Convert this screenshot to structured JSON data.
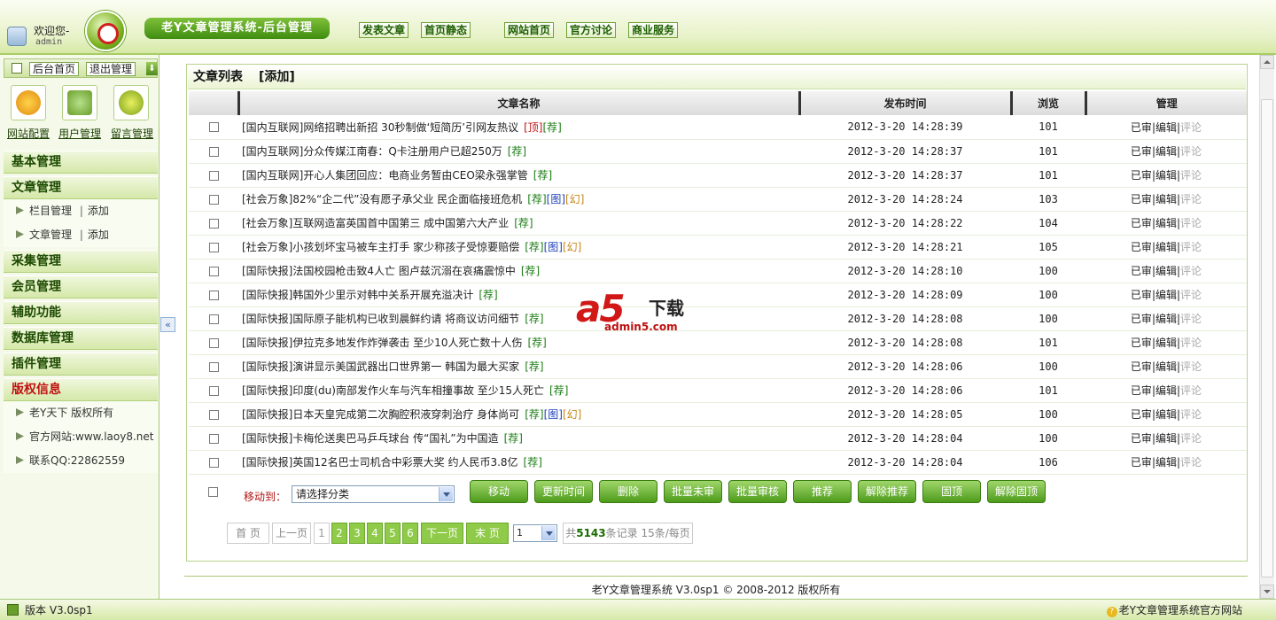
{
  "header": {
    "welcome": "欢迎您-",
    "username": "admin",
    "system_title": "老Y文章管理系统-后台管理",
    "nav": [
      "发表文章",
      "首页静态",
      "网站首页",
      "官方讨论",
      "商业服务"
    ]
  },
  "sidebar": {
    "buttons": {
      "home": "后台首页",
      "logout": "退出管理"
    },
    "icons": [
      {
        "label": "网站配置",
        "icon": "gear-icon"
      },
      {
        "label": "用户管理",
        "icon": "user-manage-icon"
      },
      {
        "label": "留言管理",
        "icon": "message-icon"
      }
    ],
    "sections": {
      "basic": "基本管理",
      "article": "文章管理",
      "article_items": [
        {
          "label": "栏目管理",
          "sep": "|",
          "action": "添加"
        },
        {
          "label": "文章管理",
          "sep": "|",
          "action": "添加"
        }
      ],
      "collect": "采集管理",
      "member": "会员管理",
      "assist": "辅助功能",
      "database": "数据库管理",
      "plugin": "插件管理",
      "copyright": "版权信息",
      "copyright_items": [
        "老Y天下 版权所有",
        "官方网站:www.laoy8.net",
        "联系QQ:22862559"
      ]
    }
  },
  "list": {
    "title": "文章列表",
    "add": "[添加]",
    "columns": [
      "文章名称",
      "发布时间",
      "浏览",
      "管理"
    ],
    "manage": {
      "approved": "已审",
      "edit": "编辑",
      "comment": "评论"
    },
    "rows": [
      {
        "title": "[国内互联网]网络招聘出新招 30秒制做‘短简历’引网友热议",
        "flags": [
          [
            "[顶]",
            "top"
          ],
          [
            "[荐]",
            "rec"
          ]
        ],
        "time": "2012-3-20 14:28:39",
        "views": "101"
      },
      {
        "title": "[国内互联网]分众传媒江南春：Q卡注册用户已超250万",
        "flags": [
          [
            "[荐]",
            "rec"
          ]
        ],
        "time": "2012-3-20 14:28:37",
        "views": "101"
      },
      {
        "title": "[国内互联网]开心人集团回应：电商业务暂由CEO梁永强掌管",
        "flags": [
          [
            "[荐]",
            "rec"
          ]
        ],
        "time": "2012-3-20 14:28:37",
        "views": "101"
      },
      {
        "title": "[社会万象]82%“企二代”没有愿子承父业 民企面临接班危机",
        "flags": [
          [
            "[荐]",
            "rec"
          ],
          [
            "[图]",
            "img"
          ],
          [
            "[幻]",
            "mag"
          ]
        ],
        "time": "2012-3-20 14:28:24",
        "views": "103"
      },
      {
        "title": "[社会万象]互联网造富英国首中国第三 成中国第六大产业",
        "flags": [
          [
            "[荐]",
            "rec"
          ]
        ],
        "time": "2012-3-20 14:28:22",
        "views": "104"
      },
      {
        "title": "[社会万象]小孩划坏宝马被车主打手 家少称孩子受惊要赔偿",
        "flags": [
          [
            "[荐]",
            "rec"
          ],
          [
            "[图]",
            "img"
          ],
          [
            "[幻]",
            "mag"
          ]
        ],
        "time": "2012-3-20 14:28:21",
        "views": "105"
      },
      {
        "title": "[国际快报]法国校园枪击致4人亡 图卢兹沉溺在哀痛震惊中",
        "flags": [
          [
            "[荐]",
            "rec"
          ]
        ],
        "time": "2012-3-20 14:28:10",
        "views": "100"
      },
      {
        "title": "[国际快报]韩国外少里示对韩中关系开展充溢决计",
        "flags": [
          [
            "[荐]",
            "rec"
          ]
        ],
        "time": "2012-3-20 14:28:09",
        "views": "100"
      },
      {
        "title": "[国际快报]国际原子能机构已收到晨鲜约请 将商议访问细节",
        "flags": [
          [
            "[荐]",
            "rec"
          ]
        ],
        "time": "2012-3-20 14:28:08",
        "views": "100"
      },
      {
        "title": "[国际快报]伊拉克多地发作炸弹袭击 至少10人死亡数十人伤",
        "flags": [
          [
            "[荐]",
            "rec"
          ]
        ],
        "time": "2012-3-20 14:28:08",
        "views": "101"
      },
      {
        "title": "[国际快报]演讲显示美国武器出口世界第一 韩国为最大买家",
        "flags": [
          [
            "[荐]",
            "rec"
          ]
        ],
        "time": "2012-3-20 14:28:06",
        "views": "100"
      },
      {
        "title": "[国际快报]印度(du)南部发作火车与汽车相撞事故 至少15人死亡",
        "flags": [
          [
            "[荐]",
            "rec"
          ]
        ],
        "time": "2012-3-20 14:28:06",
        "views": "101"
      },
      {
        "title": "[国际快报]日本天皇完成第二次胸腔积液穿刺治疗 身体尚可",
        "flags": [
          [
            "[荐]",
            "rec"
          ],
          [
            "[图]",
            "img"
          ],
          [
            "[幻]",
            "mag"
          ]
        ],
        "time": "2012-3-20 14:28:05",
        "views": "100"
      },
      {
        "title": "[国际快报]卡梅伦送奥巴马乒乓球台 传“国礼”为中国造",
        "flags": [
          [
            "[荐]",
            "rec"
          ]
        ],
        "time": "2012-3-20 14:28:04",
        "views": "100"
      },
      {
        "title": "[国际快报]英国12名巴士司机合中彩票大奖 约人民币3.8亿",
        "flags": [
          [
            "[荐]",
            "rec"
          ]
        ],
        "time": "2012-3-20 14:28:04",
        "views": "106"
      }
    ]
  },
  "actions": {
    "move_label": "移动到：",
    "category_select": "请选择分类",
    "buttons": [
      "移动",
      "更新时间",
      "删除",
      "批量未审",
      "批量审核",
      "推荐",
      "解除推荐",
      "固顶",
      "解除固顶"
    ]
  },
  "pager": {
    "first": "首 页",
    "prev": "上一页",
    "pages": [
      "1",
      "2",
      "3",
      "4",
      "5",
      "6"
    ],
    "current_page": "1",
    "next": "下一页",
    "last": "末 页",
    "select_value": "1",
    "total_prefix": "共",
    "total_count": "5143",
    "total_suffix": "条记录 15条/每页"
  },
  "watermark": {
    "logo": "a5",
    "text": "下载",
    "site": "admin5.com"
  },
  "footer": "老Y文章管理系统 V3.0sp1 © 2008-2012 版权所有",
  "statusbar": {
    "version": "版本 V3.0sp1",
    "official": "老Y文章管理系统官方网站"
  },
  "colors": {
    "accent": "#4d9b1b",
    "header_bg": "#e7f2c8",
    "alert": "#c01010"
  }
}
